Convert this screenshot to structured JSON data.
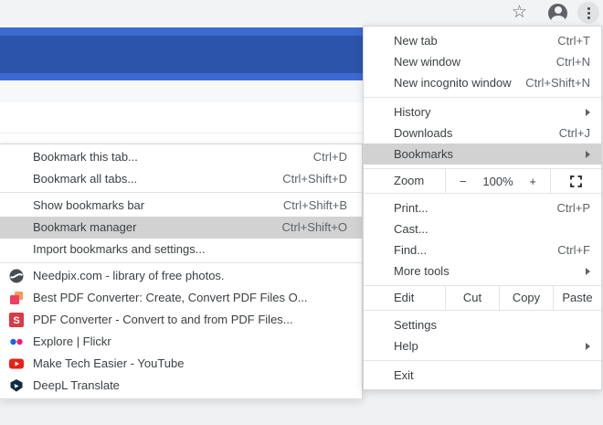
{
  "toolbar": {
    "icons": [
      "bookmark-star",
      "profile-avatar",
      "menu-kebab"
    ]
  },
  "colors": {
    "banner_blue_dark": "#2d54ab",
    "banner_blue_light": "#3c6ad1",
    "toolbar_bg": "#f1f3f4",
    "menu_bg": "#ffffff",
    "menu_highlight": "#d2d2d2",
    "page_bottom_bg": "#eef0f2"
  },
  "browser_menu": {
    "sections": [
      {
        "type": "list",
        "items": [
          {
            "label": "New tab",
            "shortcut": "Ctrl+T"
          },
          {
            "label": "New window",
            "shortcut": "Ctrl+N"
          },
          {
            "label": "New incognito window",
            "shortcut": "Ctrl+Shift+N"
          }
        ]
      },
      {
        "type": "list",
        "items": [
          {
            "label": "History",
            "submenu": true
          },
          {
            "label": "Downloads",
            "shortcut": "Ctrl+J"
          },
          {
            "label": "Bookmarks",
            "submenu": true,
            "highlighted": true
          }
        ]
      },
      {
        "type": "zoom",
        "label": "Zoom",
        "decrease": "−",
        "value": "100%",
        "increase": "+"
      },
      {
        "type": "list",
        "items": [
          {
            "label": "Print...",
            "shortcut": "Ctrl+P"
          },
          {
            "label": "Cast..."
          },
          {
            "label": "Find...",
            "shortcut": "Ctrl+F"
          },
          {
            "label": "More tools",
            "submenu": true
          }
        ]
      },
      {
        "type": "edit",
        "label": "Edit",
        "buttons": [
          "Cut",
          "Copy",
          "Paste"
        ]
      },
      {
        "type": "list",
        "items": [
          {
            "label": "Settings"
          },
          {
            "label": "Help",
            "submenu": true
          }
        ]
      },
      {
        "type": "list",
        "items": [
          {
            "label": "Exit"
          }
        ]
      }
    ]
  },
  "bookmarks_submenu": {
    "sections": [
      {
        "type": "list",
        "items": [
          {
            "label": "Bookmark this tab...",
            "shortcut": "Ctrl+D"
          },
          {
            "label": "Bookmark all tabs...",
            "shortcut": "Ctrl+Shift+D"
          }
        ]
      },
      {
        "type": "list",
        "items": [
          {
            "label": "Show bookmarks bar",
            "shortcut": "Ctrl+Shift+B"
          },
          {
            "label": "Bookmark manager",
            "shortcut": "Ctrl+Shift+O",
            "highlighted": true
          },
          {
            "label": "Import bookmarks and settings..."
          }
        ]
      },
      {
        "type": "bookmarks",
        "items": [
          {
            "title": "Needpix.com - library of free photos.",
            "icon": "needpix-globe-icon"
          },
          {
            "title": "Best PDF Converter: Create, Convert PDF Files O...",
            "icon": "pdf-converter-squares-icon"
          },
          {
            "title": "PDF Converter - Convert to and from PDF Files...",
            "icon": "soda-pdf-icon"
          },
          {
            "title": "Explore | Flickr",
            "icon": "flickr-icon"
          },
          {
            "title": "Make Tech Easier - YouTube",
            "icon": "youtube-icon"
          },
          {
            "title": "DeepL Translate",
            "icon": "deepl-icon"
          }
        ]
      }
    ]
  }
}
